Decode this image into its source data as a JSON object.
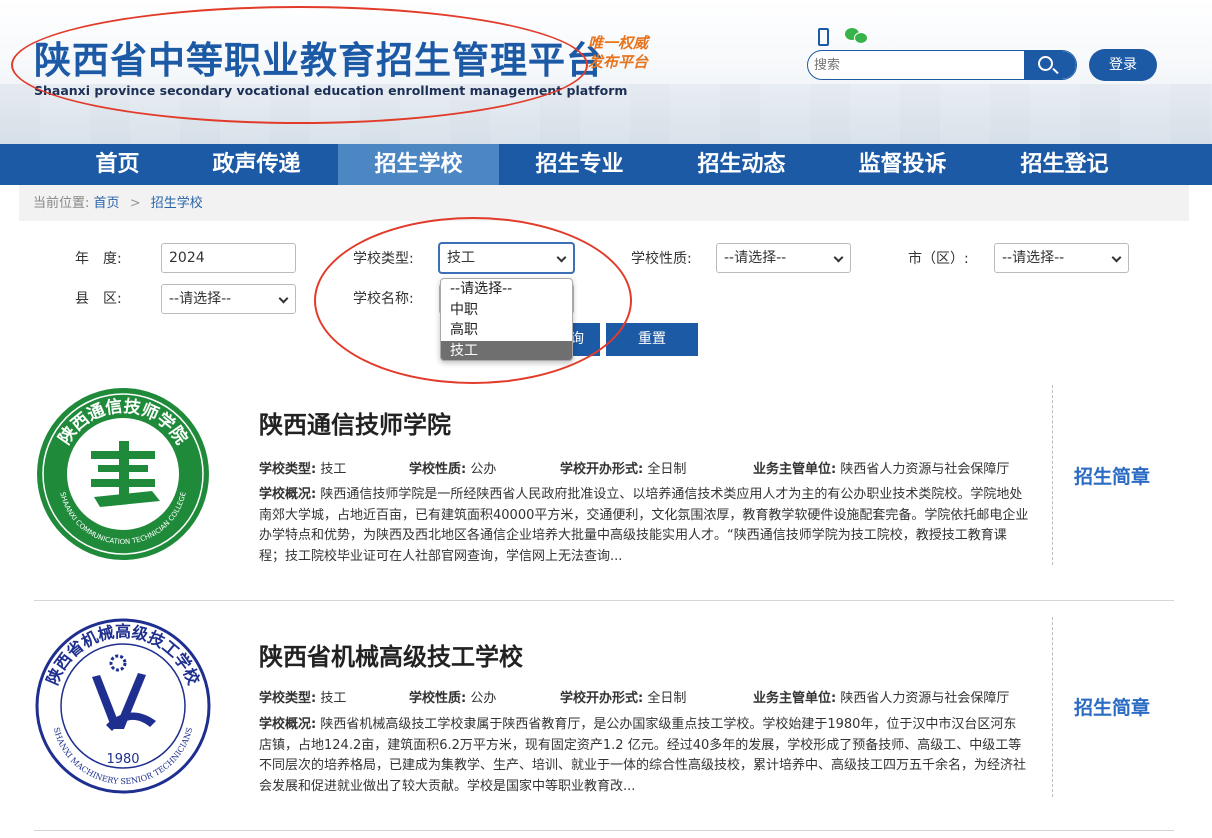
{
  "header": {
    "title": "陕西省中等职业教育招生管理平台",
    "subtitle": "Shaanxi province secondary vocational education enrollment management platform",
    "slogan_line1": "唯一权威",
    "slogan_line2": "发布平台",
    "search_placeholder": "搜索",
    "login_label": "登录"
  },
  "nav": {
    "items": [
      "首页",
      "政声传递",
      "招生学校",
      "招生专业",
      "招生动态",
      "监督投诉",
      "招生登记"
    ],
    "active": "招生学校"
  },
  "breadcrumb": {
    "prefix": "当前位置:",
    "home": "首页",
    "separator": ">",
    "current": "招生学校"
  },
  "filters": {
    "year_label": "年　度:",
    "year_value": "2024",
    "school_type_label": "学校类型:",
    "school_type_value": "技工",
    "school_nature_label": "学校性质:",
    "school_nature_value": "--请选择--",
    "city_label": "市（区）:",
    "city_value": "--请选择--",
    "county_label": "县　区:",
    "county_value": "--请选择--",
    "school_name_label": "学校名称:",
    "search_button": "查询",
    "reset_button": "重置",
    "dropdown_options": [
      "--请选择--",
      "中职",
      "高职",
      "技工"
    ],
    "dropdown_selected": "技工"
  },
  "schools": [
    {
      "name": "陕西通信技师学院",
      "type_label": "学校类型:",
      "type": "技工",
      "nature_label": "学校性质:",
      "nature": "公办",
      "form_label": "学校开办形式:",
      "form": "全日制",
      "authority_label": "业务主管单位:",
      "authority": "陕西省人力资源与社会保障厅",
      "overview_label": "学校概况:",
      "overview": "陕西通信技师学院是一所经陕西省人民政府批准设立、以培养通信技术类应用人才为主的有公办职业技术类院校。学院地处南郊大学城，占地近百亩，已有建筑面积40000平方米，交通便利，文化氛围浓厚，教育教学软硬件设施配套完备。学院依托邮电企业办学特点和优势，为陕西及西北地区各通信企业培养大批量中高级技能实用人才。“陕西通信技师学院为技工院校，教授技工教育课程；技工院校毕业证可在人社部官网查询，学信网上无法查询...",
      "brochure": "招生简章",
      "logo_text": "陕西通信技师学院",
      "logo_en": "SHAANXI COMMUNICATION TECHNICIAN COLLEGE",
      "logo_color": "#1f8a3a"
    },
    {
      "name": "陕西省机械高级技工学校",
      "type_label": "学校类型:",
      "type": "技工",
      "nature_label": "学校性质:",
      "nature": "公办",
      "form_label": "学校开办形式:",
      "form": "全日制",
      "authority_label": "业务主管单位:",
      "authority": "陕西省人力资源与社会保障厅",
      "overview_label": "学校概况:",
      "overview": "陕西省机械高级技工学校隶属于陕西省教育厅，是公办国家级重点技工学校。学校始建于1980年，位于汉中市汉台区河东店镇，占地124.2亩，建筑面积6.2万平方米，现有固定资产1.2 亿元。经过40多年的发展，学校形成了预备技师、高级工、中级工等不同层次的培养格局，已建成为集教学、生产、培训、就业于一体的综合性高级技校，累计培养中、高级技工四万五千余名，为经济社会发展和促进就业做出了较大贡献。学校是国家中等职业教育改...",
      "brochure": "招生简章",
      "logo_text": "陕西省机械高级技工学校",
      "logo_en": "SHANXI MACHINERY SENIOR TECHNICIANS",
      "logo_year": "1980",
      "logo_color": "#1f2f8f"
    }
  ]
}
